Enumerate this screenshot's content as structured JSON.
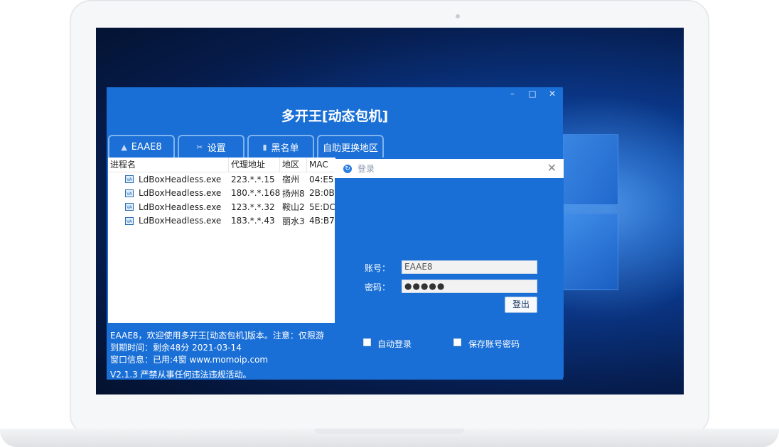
{
  "app": {
    "title": "多开王[动态包机]",
    "controls": {
      "minimize": "–",
      "maximize": "□",
      "close": "✕"
    },
    "tabs": [
      {
        "label": "EAAE8",
        "icon": "user-icon",
        "glyph": "▲"
      },
      {
        "label": "设置",
        "icon": "tools-icon",
        "glyph": "✂"
      },
      {
        "label": "黑名单",
        "icon": "trash-icon",
        "glyph": "▮"
      },
      {
        "label": "自助更换地区",
        "icon": "",
        "glyph": ""
      }
    ],
    "table": {
      "headers": [
        "进程名",
        "代理地址",
        "地区",
        "MAC"
      ],
      "rows": [
        [
          "LdBoxHeadless.exe",
          "223.*.*.15",
          "宿州",
          "04:E5"
        ],
        [
          "LdBoxHeadless.exe",
          "180.*.*.168",
          "扬州8",
          "2B:0B"
        ],
        [
          "LdBoxHeadless.exe",
          "123.*.*.32",
          "鞍山2",
          "5E:DC"
        ],
        [
          "LdBoxHeadless.exe",
          "183.*.*.43",
          "丽水3",
          "4B:B7"
        ]
      ]
    },
    "footer": {
      "line1": "EAAE8，欢迎使用多开王[动态包机]版本。注意：仅限游",
      "line2": "到期时间：剩余48分 2021-03-14",
      "line3": "窗口信息：已用:4窗 www.momoip.com",
      "version": "V2.1.3 严禁从事任何违法违规活动。"
    }
  },
  "login": {
    "title": "登录",
    "close": "✕",
    "account_label": "账号：",
    "account_value": "EAAE8",
    "password_label": "密码：",
    "password_value": "●●●●●",
    "logout_label": "登出",
    "auto_login_label": "自动登录",
    "save_password_label": "保存账号密码"
  }
}
